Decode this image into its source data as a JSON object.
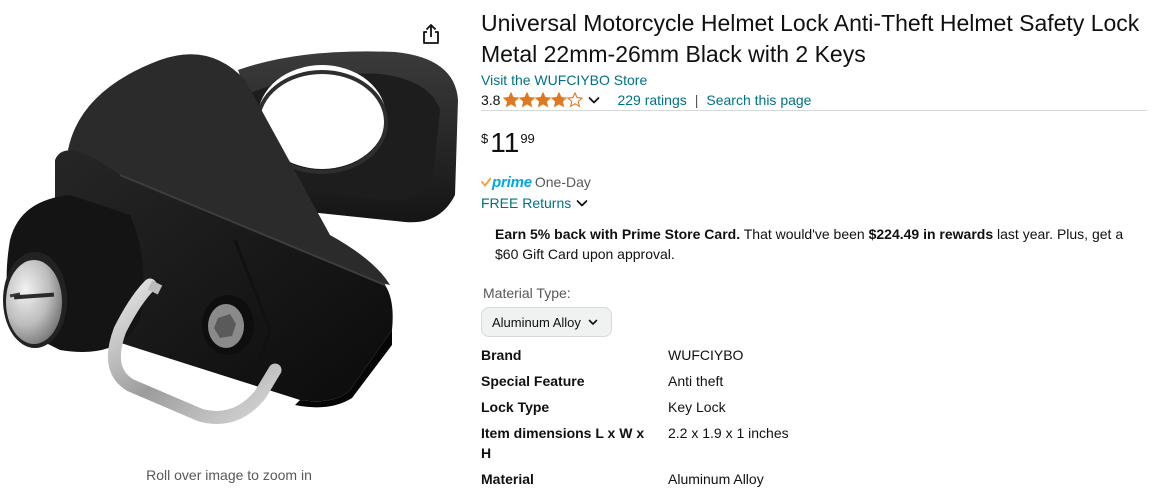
{
  "gallery": {
    "zoom_hint": "Roll over image to zoom in",
    "share_icon": "share-icon"
  },
  "product": {
    "title": "Universal Motorcycle Helmet Lock Anti-Theft Helmet Safety Lock Metal 22mm-26mm Black with 2 Keys",
    "store_link": "Visit the WUFCIYBO Store",
    "rating": "3.8",
    "rating_value": 3.8,
    "ratings_count": "229 ratings",
    "separator": "|",
    "search_link": "Search this page"
  },
  "price": {
    "symbol": "$",
    "whole": "11",
    "fraction": "99"
  },
  "prime": {
    "brand": "prime",
    "label": "One-Day",
    "returns": "FREE Returns"
  },
  "promo": {
    "bold1": "Earn 5% back with Prime Store Card.",
    "text1": " That would've been ",
    "bold2": "$224.49 in rewards",
    "text2": " last year. Plus, get a $60 Gift Card upon approval."
  },
  "material": {
    "label": "Material Type:",
    "selected": "Aluminum Alloy"
  },
  "specs": [
    {
      "key": "Brand",
      "value": "WUFCIYBO"
    },
    {
      "key": "Special Feature",
      "value": "Anti theft"
    },
    {
      "key": "Lock Type",
      "value": "Key Lock"
    },
    {
      "key": "Item dimensions L x W x H",
      "value": "2.2 x 1.9 x 1 inches"
    },
    {
      "key": "Material",
      "value": "Aluminum Alloy"
    }
  ],
  "colors": {
    "link": "#007185",
    "star": "#de7921",
    "prime": "#00a8e1",
    "text": "#0f1111"
  }
}
